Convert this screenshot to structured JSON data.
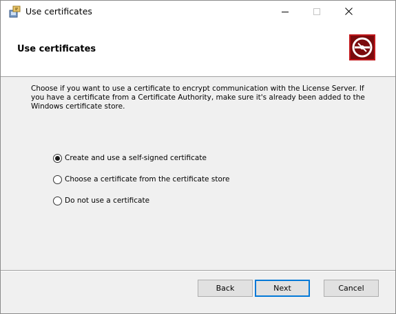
{
  "window": {
    "title": "Use certificates",
    "icon": "installer-icon",
    "controls": {
      "minimize": "minimize-icon",
      "maximize": "maximize-icon",
      "close": "close-icon"
    }
  },
  "header": {
    "title": "Use certificates",
    "logo": "satellite-dish-logo",
    "logo_color": "#c0171b"
  },
  "description": {
    "lines": [
      "Choose if you want to use a certificate to encrypt communication with the License Server. If",
      "you have a certificate from a Certificate Authority, make sure it's already been added to the",
      "Windows certificate store."
    ]
  },
  "options": [
    {
      "label": "Create and use a self-signed certificate",
      "checked": true
    },
    {
      "label": "Choose a certificate from the certificate store",
      "checked": false
    },
    {
      "label": "Do not use a certificate",
      "checked": false
    }
  ],
  "buttons": {
    "back": "Back",
    "next": "Next",
    "cancel": "Cancel"
  },
  "colors": {
    "accent": "#0078d7",
    "brand": "#c0171b"
  }
}
